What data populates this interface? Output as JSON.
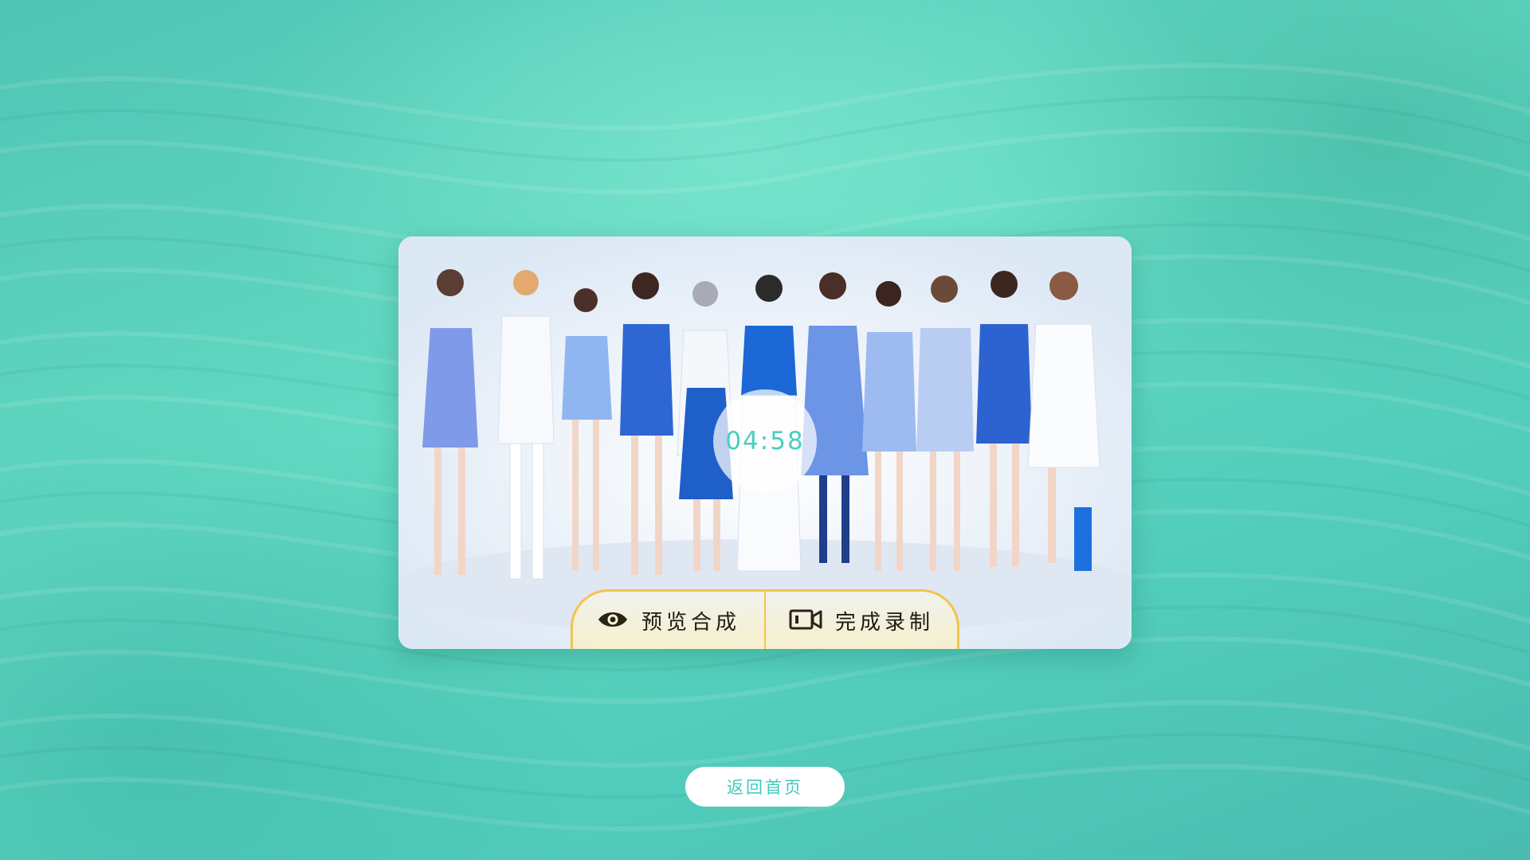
{
  "timer": {
    "display": "04:58"
  },
  "actions": {
    "preview": {
      "label": "预览合成",
      "icon": "eye-icon"
    },
    "finish": {
      "label": "完成录制",
      "icon": "video-camera-icon"
    }
  },
  "navigation": {
    "home_label": "返回首页"
  },
  "colors": {
    "accent_teal": "#47cfc0",
    "gold_border": "#f2c54a",
    "background": "#56cdb8"
  }
}
